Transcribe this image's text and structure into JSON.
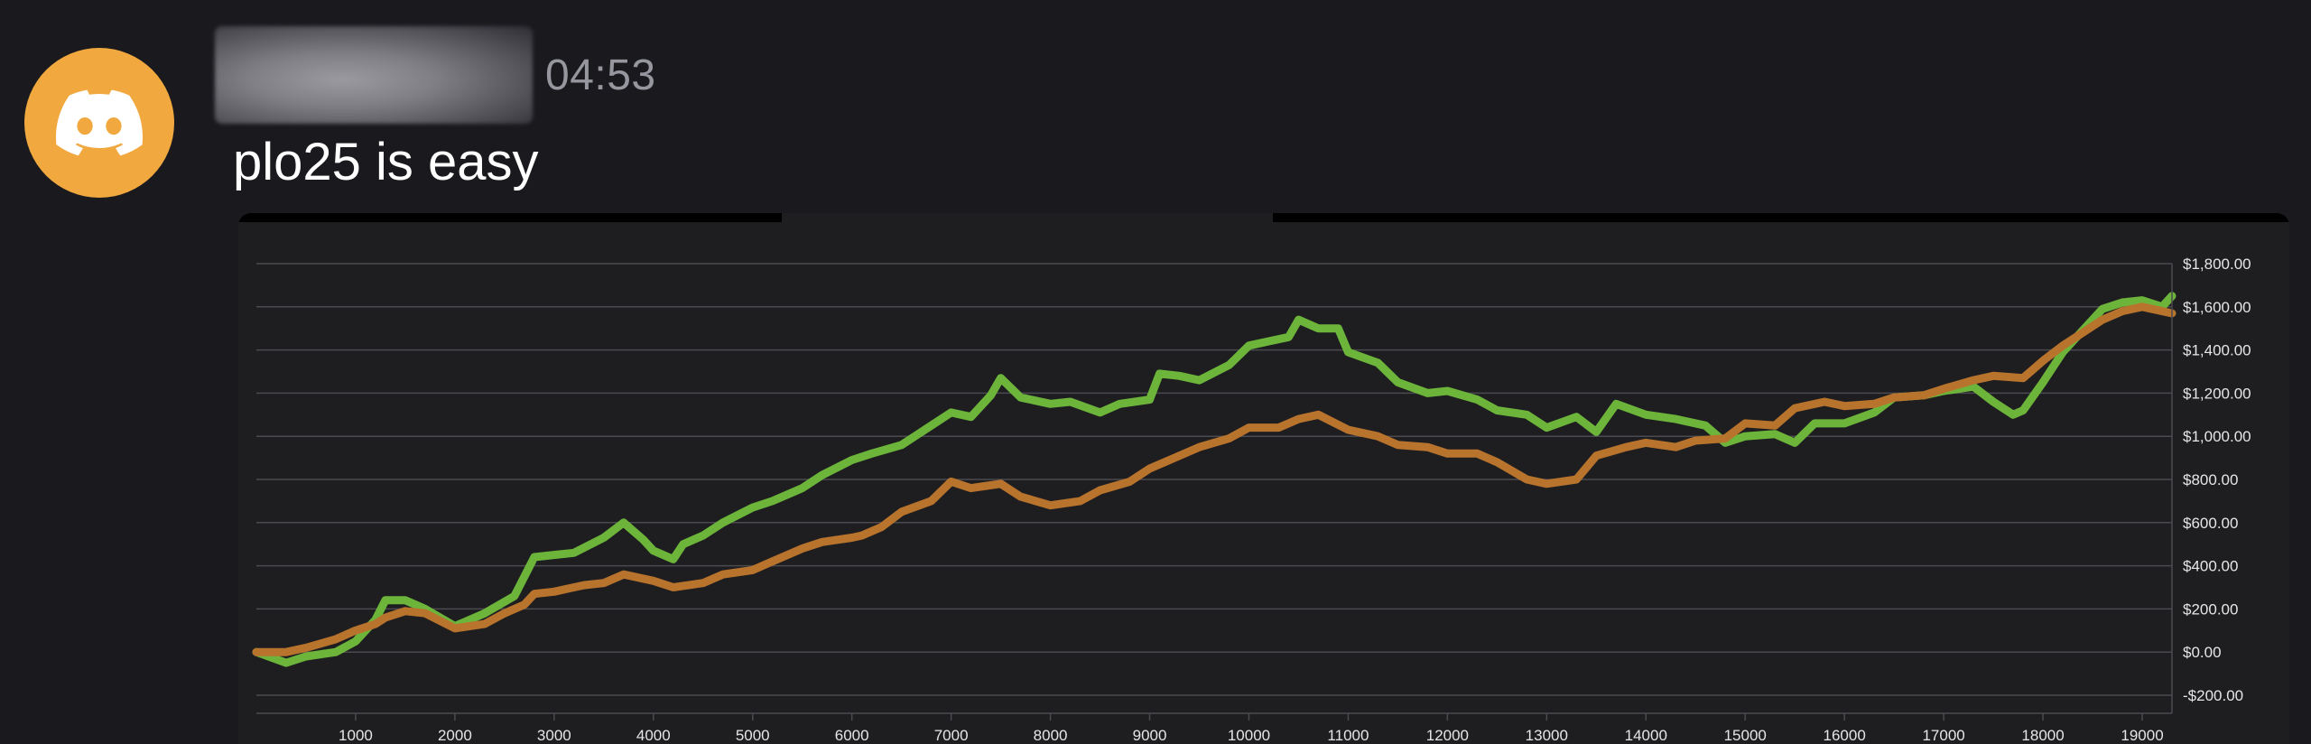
{
  "message": {
    "username": "user",
    "timestamp": "04:53",
    "text": "plo25 is easy"
  },
  "avatar": {
    "icon": "discord-icon",
    "color": "#f0a83f"
  },
  "colors": {
    "background": "#1a1a1e",
    "chart_background": "#1e1e21",
    "grid": "#4a4a50",
    "tick_text": "#e6e6e6",
    "series_green": "#6cb43a",
    "series_orange": "#b8732c"
  },
  "chart_data": {
    "type": "line",
    "title": "",
    "xlabel": "",
    "ylabel": "",
    "xlim": [
      0,
      19300
    ],
    "ylim": [
      -200,
      1800
    ],
    "y_axis_position": "right",
    "grid": true,
    "x_ticks": [
      1000,
      2000,
      3000,
      4000,
      5000,
      6000,
      7000,
      8000,
      9000,
      10000,
      11000,
      12000,
      13000,
      14000,
      15000,
      16000,
      17000,
      18000,
      19000
    ],
    "x_tick_labels": [
      "1000",
      "2000",
      "3000",
      "4000",
      "5000",
      "6000",
      "7000",
      "8000",
      "9000",
      "10000",
      "11000",
      "12000",
      "13000",
      "14000",
      "15000",
      "16000",
      "17000",
      "18000",
      "19000"
    ],
    "y_ticks": [
      -200,
      0,
      200,
      400,
      600,
      800,
      1000,
      1200,
      1400,
      1600,
      1800
    ],
    "y_tick_labels": [
      "-$200.00",
      "$0.00",
      "$200.00",
      "$400.00",
      "$600.00",
      "$800.00",
      "$1,000.00",
      "$1,200.00",
      "$1,400.00",
      "$1,600.00",
      "$1,800.00"
    ],
    "series": [
      {
        "color": "#6cb43a",
        "x": [
          0,
          300,
          500,
          800,
          1000,
          1200,
          1300,
          1500,
          1700,
          2000,
          2300,
          2600,
          2800,
          3000,
          3200,
          3500,
          3700,
          3900,
          4000,
          4200,
          4300,
          4500,
          4700,
          5000,
          5200,
          5500,
          5700,
          6000,
          6200,
          6500,
          6800,
          7000,
          7200,
          7400,
          7500,
          7700,
          8000,
          8200,
          8500,
          8700,
          9000,
          9100,
          9300,
          9500,
          9800,
          10000,
          10200,
          10400,
          10500,
          10700,
          10900,
          11000,
          11300,
          11500,
          11800,
          12000,
          12300,
          12500,
          12800,
          13000,
          13300,
          13500,
          13700,
          14000,
          14300,
          14600,
          14800,
          15000,
          15300,
          15500,
          15700,
          16000,
          16300,
          16500,
          16800,
          17000,
          17300,
          17500,
          17700,
          17800,
          18000,
          18200,
          18400,
          18600,
          18800,
          19000,
          19200,
          19300
        ],
        "y": [
          0,
          -50,
          -20,
          0,
          50,
          150,
          240,
          240,
          200,
          120,
          180,
          260,
          440,
          450,
          460,
          530,
          600,
          520,
          470,
          430,
          500,
          540,
          600,
          670,
          700,
          760,
          820,
          890,
          920,
          960,
          1050,
          1110,
          1090,
          1190,
          1270,
          1180,
          1150,
          1160,
          1110,
          1150,
          1170,
          1290,
          1280,
          1260,
          1330,
          1420,
          1440,
          1460,
          1540,
          1500,
          1500,
          1390,
          1340,
          1250,
          1200,
          1210,
          1170,
          1120,
          1100,
          1040,
          1090,
          1020,
          1150,
          1100,
          1080,
          1050,
          970,
          1000,
          1010,
          970,
          1060,
          1060,
          1110,
          1180,
          1190,
          1210,
          1230,
          1160,
          1100,
          1120,
          1250,
          1390,
          1490,
          1590,
          1620,
          1630,
          1600,
          1650
        ]
      },
      {
        "color": "#b8732c",
        "x": [
          0,
          300,
          500,
          800,
          1000,
          1200,
          1300,
          1500,
          1700,
          2000,
          2300,
          2500,
          2700,
          2800,
          3000,
          3300,
          3500,
          3700,
          4000,
          4200,
          4500,
          4700,
          5000,
          5200,
          5500,
          5700,
          6000,
          6100,
          6300,
          6500,
          6800,
          7000,
          7200,
          7500,
          7700,
          8000,
          8300,
          8500,
          8800,
          9000,
          9300,
          9500,
          9800,
          10000,
          10300,
          10500,
          10700,
          11000,
          11300,
          11500,
          11800,
          12000,
          12300,
          12500,
          12800,
          13000,
          13300,
          13500,
          13800,
          14000,
          14300,
          14500,
          14800,
          15000,
          15300,
          15500,
          15800,
          16000,
          16300,
          16500,
          16800,
          17000,
          17300,
          17500,
          17800,
          18000,
          18200,
          18400,
          18600,
          18800,
          19000,
          19300
        ],
        "y": [
          0,
          0,
          20,
          60,
          100,
          130,
          160,
          190,
          180,
          110,
          130,
          180,
          220,
          270,
          280,
          310,
          320,
          360,
          330,
          300,
          320,
          360,
          380,
          420,
          480,
          510,
          530,
          540,
          580,
          650,
          700,
          790,
          760,
          780,
          720,
          680,
          700,
          750,
          790,
          850,
          910,
          950,
          990,
          1040,
          1040,
          1080,
          1100,
          1030,
          1000,
          960,
          950,
          920,
          920,
          880,
          800,
          780,
          800,
          910,
          950,
          970,
          950,
          980,
          990,
          1060,
          1050,
          1130,
          1160,
          1140,
          1150,
          1180,
          1190,
          1220,
          1260,
          1280,
          1270,
          1350,
          1420,
          1480,
          1540,
          1580,
          1600,
          1570
        ]
      }
    ]
  }
}
